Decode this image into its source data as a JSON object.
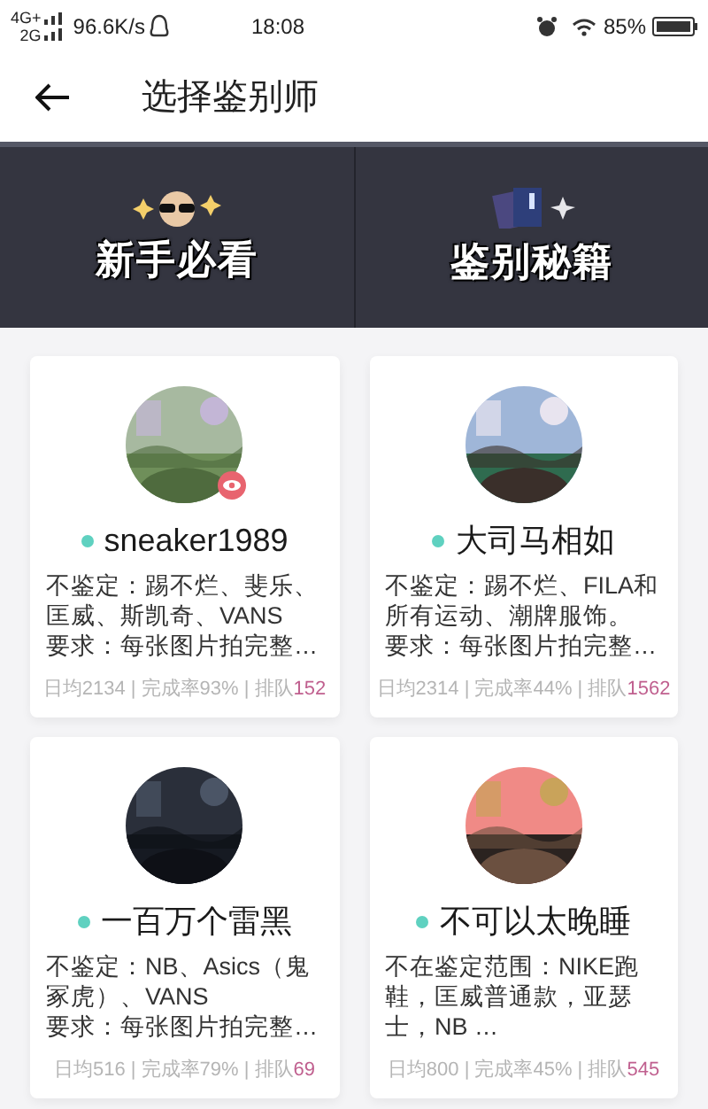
{
  "status_bar": {
    "network_top": "4G+",
    "network_bottom": "2G",
    "speed": "96.6K/s",
    "time": "18:08",
    "battery": "85%"
  },
  "header": {
    "title": "选择鉴别师"
  },
  "banners": [
    {
      "kind": "guide",
      "label": "新手必看"
    },
    {
      "kind": "secrets",
      "label": "鉴别秘籍"
    }
  ],
  "appraisers": [
    {
      "name": "sneaker1989",
      "online": true,
      "badge": true,
      "lines": [
        "不鉴定：踢不烂、斐乐、匡威、斯凯奇、VANS",
        "要求：每张图片拍完整…"
      ],
      "stats": "日均2134 | 完成率93% | 排队",
      "queue": "152"
    },
    {
      "name": "大司马相如",
      "online": true,
      "badge": false,
      "lines": [
        "不鉴定：踢不烂、FILA和所有运动、潮牌服饰。",
        "要求：每张图片拍完整…"
      ],
      "stats": "日均2314 | 完成率44% | 排队",
      "queue": "1562"
    },
    {
      "name": "一百万个雷黑",
      "online": true,
      "badge": false,
      "lines": [
        "不鉴定：NB、Asics（鬼冢虎）、VANS",
        "要求：每张图片拍完整…"
      ],
      "stats": "日均516 | 完成率79% | 排队",
      "queue": "69"
    },
    {
      "name": "不可以太晚睡",
      "online": true,
      "badge": false,
      "lines": [
        "不在鉴定范围：NIKE跑鞋，匡威普通款，亚瑟士，NB …"
      ],
      "stats": "日均800 | 完成率45% | 排队",
      "queue": "545"
    }
  ]
}
